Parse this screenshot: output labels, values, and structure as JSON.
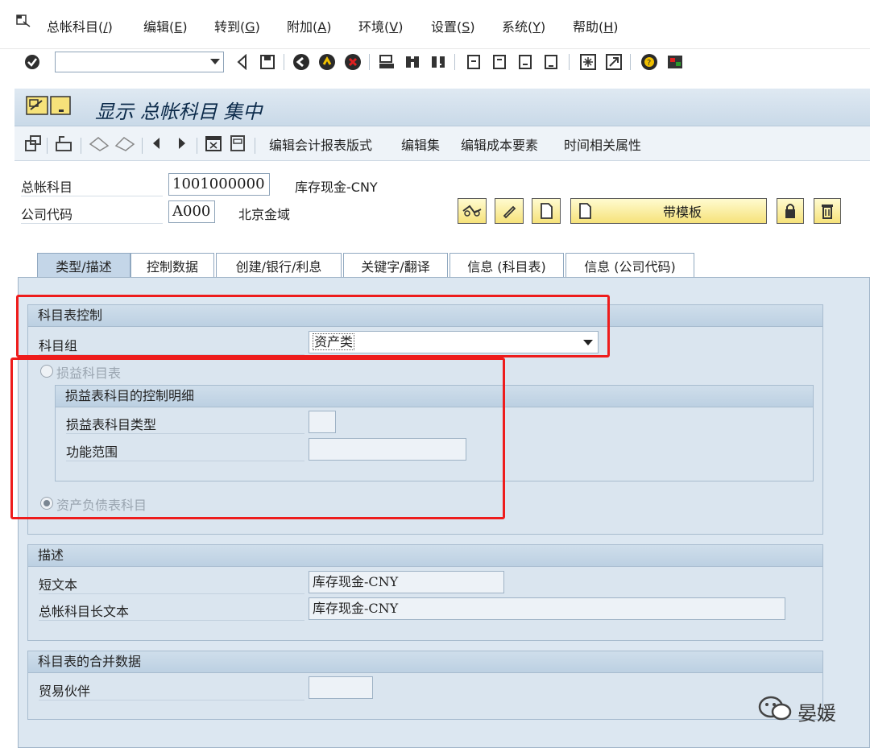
{
  "menu": [
    {
      "label": "总帐科目(",
      "key": "/",
      "suffix": ")"
    },
    {
      "label": "编辑(",
      "key": "E",
      "suffix": ")"
    },
    {
      "label": "转到(",
      "key": "G",
      "suffix": ")"
    },
    {
      "label": "附加(",
      "key": "A",
      "suffix": ")"
    },
    {
      "label": "环境(",
      "key": "V",
      "suffix": ")"
    },
    {
      "label": "设置(",
      "key": "S",
      "suffix": ")"
    },
    {
      "label": "系统(",
      "key": "Y",
      "suffix": ")"
    },
    {
      "label": "帮助(",
      "key": "H",
      "suffix": ")"
    }
  ],
  "command_field": {
    "value": ""
  },
  "title": "显示 总帐科目 集中",
  "app_toolbar": {
    "buttons": [
      "编辑会计报表版式",
      "编辑集",
      "编辑成本要素",
      "时间相关属性"
    ]
  },
  "header": {
    "gl_account_label": "总帐科目",
    "gl_account_value": "1001000000",
    "gl_account_desc": "库存现金-CNY",
    "company_code_label": "公司代码",
    "company_code_value": "A000",
    "company_code_desc": "北京金域",
    "template_button": "带模板"
  },
  "tabs": [
    {
      "label": "类型/描述",
      "active": true
    },
    {
      "label": "控制数据",
      "active": false
    },
    {
      "label": "创建/银行/利息",
      "active": false
    },
    {
      "label": "关键字/翻译",
      "active": false
    },
    {
      "label": "信息 (科目表)",
      "active": false
    },
    {
      "label": "信息 (公司代码)",
      "active": false
    }
  ],
  "coa_control": {
    "title": "科目表控制",
    "account_group_label": "科目组",
    "account_group_value": "资产类"
  },
  "pl": {
    "radio_label": "损益科目表",
    "selected": false,
    "detail_title": "损益表科目的控制明细",
    "pl_type_label": "损益表科目类型",
    "pl_type_value": "",
    "func_area_label": "功能范围",
    "func_area_value": ""
  },
  "bs": {
    "radio_label": "资产负债表科目",
    "selected": true
  },
  "description": {
    "title": "描述",
    "short_text_label": "短文本",
    "short_text_value": "库存现金-CNY",
    "long_text_label": "总帐科目长文本",
    "long_text_value": "库存现金-CNY"
  },
  "consolidation": {
    "title": "科目表的合并数据",
    "trading_partner_label": "贸易伙伴",
    "trading_partner_value": ""
  },
  "watermark": "晏媛",
  "colors": {
    "highlight_red": "#ee1c1c",
    "panel_bg": "#dce7f1",
    "button_yellow": "#f6e27a",
    "title_text": "#0b2a4a"
  }
}
